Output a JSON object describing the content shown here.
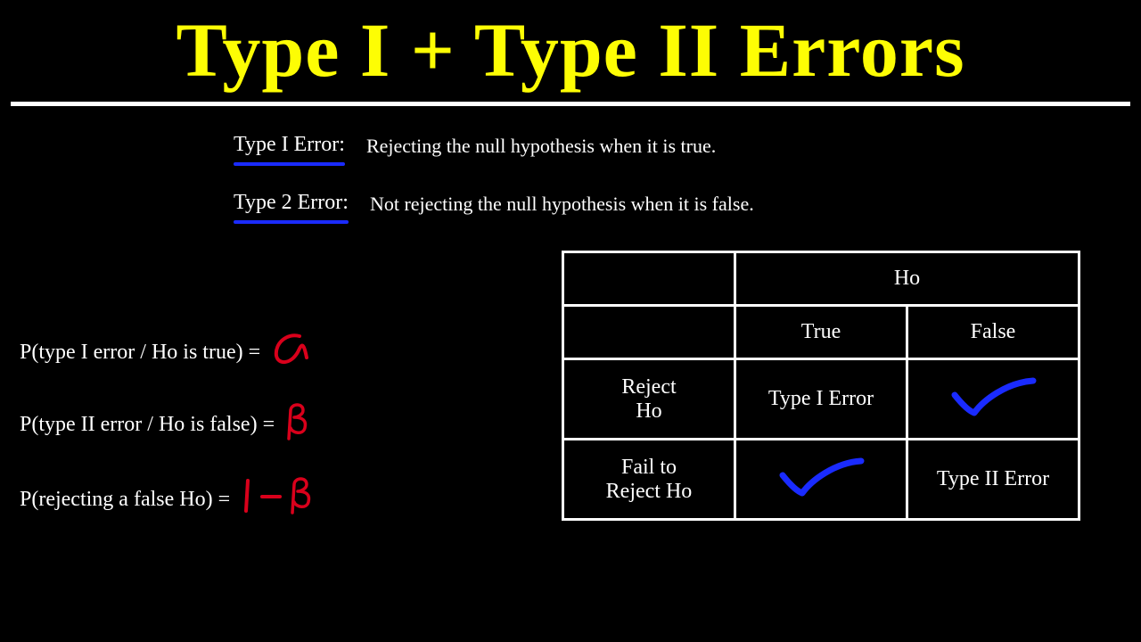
{
  "title": "Type I + Type II Errors",
  "definitions": {
    "type1": {
      "label": "Type I Error:",
      "text": "Rejecting the null hypothesis when it is true."
    },
    "type2": {
      "label": "Type 2 Error:",
      "text": "Not rejecting the null hypothesis when it is false."
    }
  },
  "formulas": {
    "f1": {
      "text": "P(type I error / Ho is true)  =",
      "symbol": "α"
    },
    "f2": {
      "text": "P(type II error / Ho is false)  =",
      "symbol": "β"
    },
    "f3": {
      "text": "P(rejecting a false Ho)  =",
      "symbol": "1 − β"
    }
  },
  "table": {
    "header_top": "Ho",
    "header_true": "True",
    "header_false": "False",
    "row_reject_label": "Reject\nHo",
    "row_reject_true": "Type I Error",
    "row_fail_label": "Fail to\nReject Ho",
    "row_fail_false": "Type II Error"
  }
}
